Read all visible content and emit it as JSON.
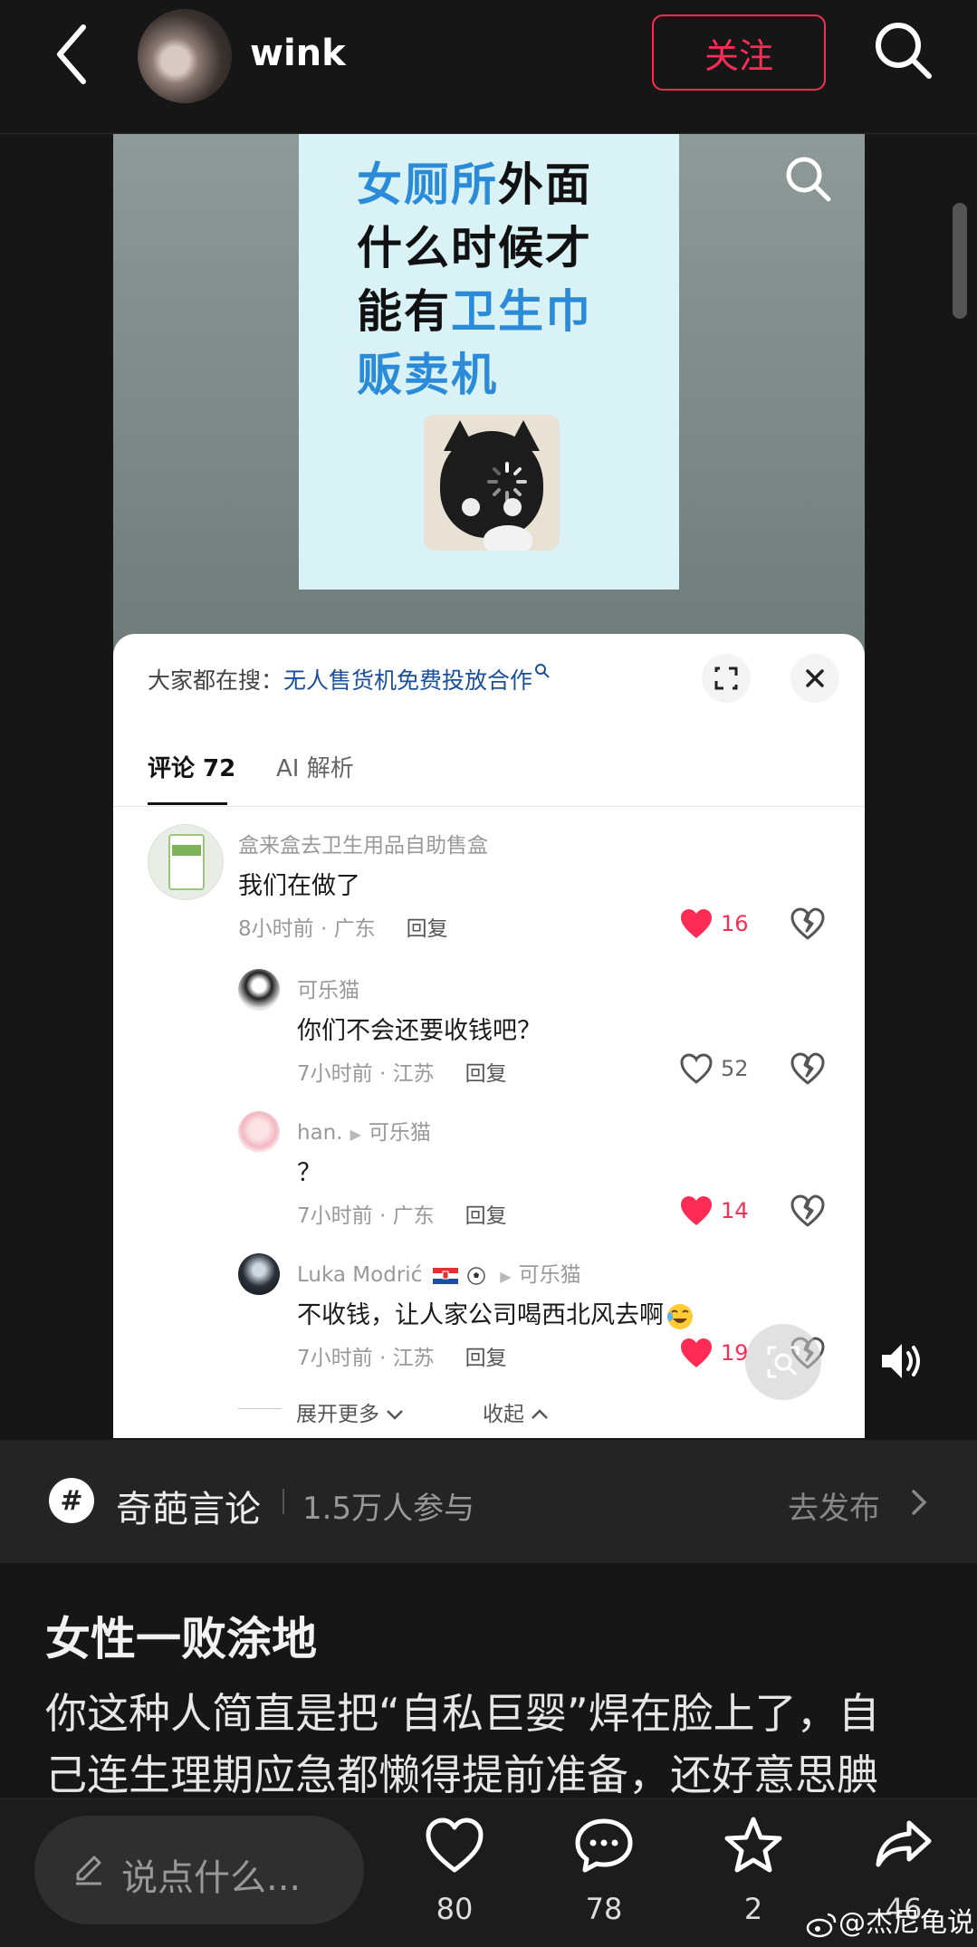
{
  "header": {
    "author": "wink",
    "follow_label": "关注"
  },
  "poster": {
    "line1_hl": "女厕所",
    "line1_rest": "外面",
    "line2": "什么时候才",
    "line3_pre": "能有",
    "line3_hl": "卫生巾",
    "line4_hl": "贩卖机"
  },
  "panel": {
    "trend_label": "大家都在搜：",
    "trend_query": "无人售货机免费投放合作",
    "tabs": [
      "评论 72",
      "AI 解析"
    ],
    "comments": [
      {
        "name": "盒来盒去卫生用品自助售盒",
        "text": "我们在做了",
        "time": "8小时前",
        "region": "广东",
        "reply": "回复",
        "likes": "16",
        "liked": true
      },
      {
        "name": "可乐猫",
        "text": "你们不会还要收钱吧？",
        "time": "7小时前",
        "region": "江苏",
        "reply": "回复",
        "likes": "52",
        "liked": false
      },
      {
        "name": "han.",
        "to": "可乐猫",
        "text": "？",
        "time": "7小时前",
        "region": "广东",
        "reply": "回复",
        "likes": "14",
        "liked": true
      },
      {
        "name": "Luka Modrić",
        "to": "可乐猫",
        "text": "不收钱，让人家公司喝西北风去啊",
        "time": "7小时前",
        "region": "江苏",
        "reply": "回复",
        "likes": "19",
        "liked": true
      }
    ],
    "more_label": "展开更多",
    "collapse_label": "收起"
  },
  "topic": {
    "name": "奇葩言论",
    "count": "1.5万人参与",
    "go": "去发布"
  },
  "post": {
    "title": "女性一败涂地",
    "line1": "你这种人简直是把“自私巨婴”焊在脸上了，自",
    "line2": "己连生理期应急都懒得提前准备，还好意思腆"
  },
  "bottom": {
    "placeholder": "说点什么...",
    "likes": "80",
    "comments": "78",
    "favorites": "2",
    "shares": "46"
  },
  "watermark": "@杰尼龟说",
  "colors": {
    "accent": "#fe2c55",
    "link": "#1a4f9c",
    "poster_highlight": "#2b8bd8"
  }
}
